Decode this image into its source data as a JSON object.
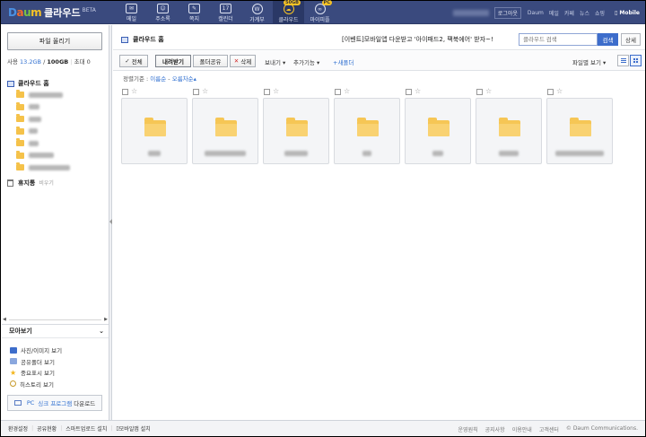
{
  "header": {
    "logo_text": "Daum",
    "service_name": "클라우드",
    "beta_label": "BETA",
    "nav": [
      {
        "label": "메일",
        "icon": "mail-icon",
        "glyph": "✉"
      },
      {
        "label": "주소록",
        "icon": "contacts-icon",
        "glyph": "☺"
      },
      {
        "label": "쪽지",
        "icon": "memo-icon",
        "glyph": "✎"
      },
      {
        "label": "캘린더",
        "icon": "calendar-icon",
        "glyph": "17"
      },
      {
        "label": "가계부",
        "icon": "wallet-icon",
        "glyph": "W"
      },
      {
        "label": "클라우드",
        "icon": "cloud-icon",
        "glyph": "☁",
        "badge": "50GB"
      },
      {
        "label": "마이피플",
        "icon": "mypeople-icon",
        "glyph": "∞",
        "badge": "PC"
      }
    ],
    "logout": "로그아웃",
    "links": [
      "Daum",
      "메일",
      "카페",
      "뉴스",
      "쇼핑"
    ],
    "mobile": "Mobile"
  },
  "sidebar": {
    "upload_button": "파일 올리기",
    "usage": {
      "prefix": "사용",
      "used": "13.2GB",
      "sep": "/",
      "total": "100GB",
      "extra": "초대 0"
    },
    "root_label": "클라우드 홈",
    "trash_label": "휴지통",
    "trash_empty": "비우기",
    "moa_title": "모아보기",
    "moa_items": [
      {
        "label": "사진/이미지 보기",
        "icon": "photo-icon",
        "color": "#3d6dcb"
      },
      {
        "label": "공유폴더 보기",
        "icon": "shared-folder-icon",
        "color": "#8aa7de"
      },
      {
        "label": "중요표시 보기",
        "icon": "star-icon",
        "color": "#f3b51b"
      },
      {
        "label": "히스토리 보기",
        "icon": "history-icon",
        "color": "#c89b2d"
      }
    ],
    "pc_sync": {
      "prefix": "PC",
      "highlight": "싱크 프로그램",
      "suffix": "다운로드"
    }
  },
  "main": {
    "breadcrumb": "클라우드 홈",
    "event_text": "[이벤트]모바일앱 다운받고 '아이패드2, 팩북에어' 받자~!",
    "search_placeholder": "클라우드 검색",
    "search_button": "검색",
    "detail_button": "상세",
    "toolbar": {
      "select_all": "전체",
      "download": "내려받기",
      "share": "폴더공유",
      "delete": "삭제",
      "send": "보내기",
      "more": "추가기능",
      "new_folder": "새폴더",
      "view_by": "파일별 보기"
    },
    "sort": {
      "prefix": "정렬기준 :",
      "by": "이름순",
      "sep": "-",
      "order": "오름차순"
    }
  },
  "footer": {
    "left": [
      "환경설정",
      "공유현황",
      "스마트업로드 설치",
      "모바일앱 설치"
    ],
    "right": [
      "운영원칙",
      "공지사항",
      "이용안내",
      "고객센터",
      "© Daum Communications."
    ]
  },
  "colors": {
    "topbar": "#3a4a7e",
    "accent": "#3d6dcb",
    "folder": "#f6c655"
  }
}
